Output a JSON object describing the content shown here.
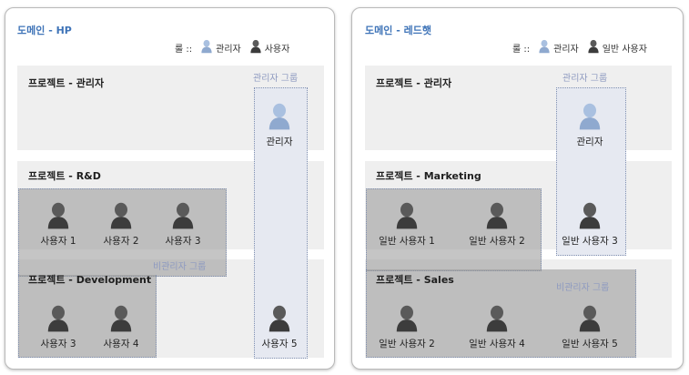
{
  "left": {
    "domain_title": "도메인 - HP",
    "legend": {
      "prefix": "룰 ::",
      "admin": "관리자",
      "user": "사용자"
    },
    "projects": {
      "admin": "프로젝트 - 관리자",
      "rd": "프로젝트 - R&D",
      "dev": "프로젝트 - Development"
    },
    "groups": {
      "admin": "관리자 그룹",
      "nonadmin": "비관리자 그룹"
    },
    "people": {
      "admin": "관리자",
      "u1": "사용자 1",
      "u2": "사용자 2",
      "u3": "사용자 3",
      "u3b": "사용자 3",
      "u4": "사용자 4",
      "u5": "사용자 5"
    }
  },
  "right": {
    "domain_title": "도메인 - 레드햇",
    "legend": {
      "prefix": "룰 ::",
      "admin": "관리자",
      "user": "일반 사용자"
    },
    "projects": {
      "admin": "프로젝트 - 관리자",
      "marketing": "프로젝트 - Marketing",
      "sales": "프로젝트 - Sales"
    },
    "groups": {
      "admin": "관리자 그룹",
      "nonadmin": "비관리자 그룹"
    },
    "people": {
      "admin": "관리자",
      "u1": "일반 사용자 1",
      "u2": "일반 사용자 2",
      "u3": "일반 사용자 3",
      "u2b": "일반 사용자 2",
      "u4": "일반 사용자 4",
      "u5": "일반 사용자 5"
    }
  },
  "colors": {
    "admin_icon": "#8fa9cf",
    "user_icon": "#4a4a4a",
    "title": "#3f74b8",
    "group_label": "#8e9ac0"
  },
  "icons": {
    "admin": "admin-person-icon",
    "user": "user-person-icon"
  }
}
